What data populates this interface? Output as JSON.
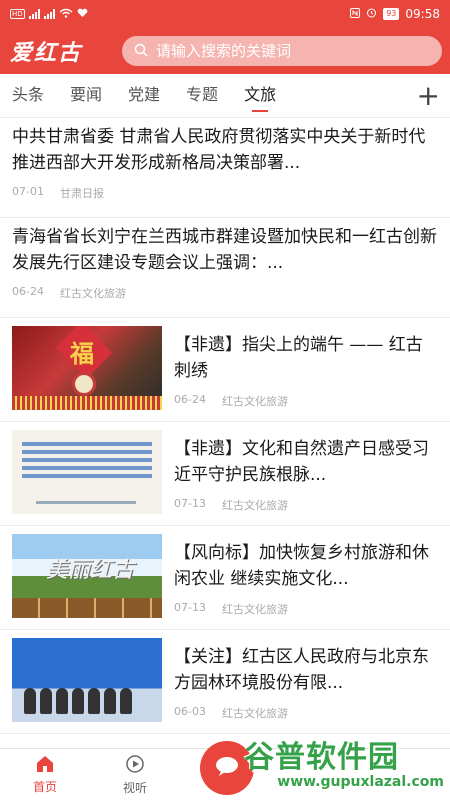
{
  "statusbar": {
    "time": "09:58",
    "battery": "93",
    "network_badge": "HD"
  },
  "header": {
    "logo": "爱红古",
    "search_placeholder": "请输入搜索的关键词"
  },
  "tabs": [
    {
      "label": "头条",
      "active": false
    },
    {
      "label": "要闻",
      "active": false
    },
    {
      "label": "党建",
      "active": false
    },
    {
      "label": "专题",
      "active": false
    },
    {
      "label": "文旅",
      "active": true
    }
  ],
  "feed": {
    "text_items": [
      {
        "title": "中共甘肃省委 甘肃省人民政府贯彻落实中央关于新时代推进西部大开发形成新格局决策部署...",
        "date": "07-01",
        "source": "甘肃日报"
      },
      {
        "title": "青海省省长刘宁在兰西城市群建设暨加快民和一红古创新发展先行区建设专题会议上强调：...",
        "date": "06-24",
        "source": "红古文化旅游"
      }
    ],
    "image_items": [
      {
        "title": "【非遗】指尖上的端午 —— 红古刺绣",
        "date": "06-24",
        "source": "红古文化旅游",
        "thumb_text": "福"
      },
      {
        "title": "【非遗】文化和自然遗产日感受习近平守护民族根脉...",
        "date": "07-13",
        "source": "红古文化旅游",
        "thumb_text": ""
      },
      {
        "title": "【风向标】加快恢复乡村旅游和休闲农业 继续实施文化...",
        "date": "07-13",
        "source": "红古文化旅游",
        "thumb_text": "美丽红古"
      },
      {
        "title": "【关注】红古区人民政府与北京东方园林环境股份有限...",
        "date": "06-03",
        "source": "红古文化旅游",
        "thumb_text": ""
      }
    ]
  },
  "bottomnav": {
    "home": "首页",
    "video": "视听"
  },
  "watermark": {
    "title": "谷普软件园",
    "url": "www.gupuxlazal.com"
  },
  "colors": {
    "brand_red": "#e8453c",
    "watermark_green": "#35a24a"
  }
}
